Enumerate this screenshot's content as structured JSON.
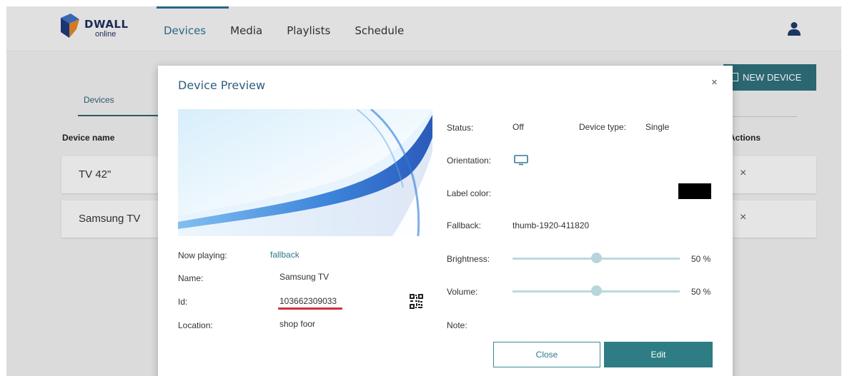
{
  "header": {
    "logo_word": "DWALL",
    "logo_sub": "online",
    "nav": [
      "Devices",
      "Media",
      "Playlists",
      "Schedule"
    ]
  },
  "page": {
    "new_device_label": "NEW DEVICE",
    "subtab_label": "Devices",
    "columns": {
      "device_name": "Device name",
      "actions": "Actions"
    },
    "rows": [
      {
        "name": "TV 42\"",
        "action": "×"
      },
      {
        "name": "Samsung TV",
        "action": "×"
      }
    ]
  },
  "modal": {
    "title": "Device Preview",
    "close_glyph": "×",
    "left_fields": [
      {
        "label": "Now playing:",
        "value": "fallback"
      },
      {
        "label": "Name:",
        "value": "Samsung TV"
      },
      {
        "label": "Id:",
        "value": "103662309033"
      },
      {
        "label": "Location:",
        "value": "shop foor"
      }
    ],
    "status": {
      "label": "Status:",
      "value": "Off"
    },
    "device_type": {
      "label": "Device type:",
      "value": "Single"
    },
    "orientation": {
      "label": "Orientation:",
      "icon": "monitor-landscape-icon"
    },
    "label_color": {
      "label": "Label color:",
      "color": "#000000"
    },
    "fallback": {
      "label": "Fallback:",
      "value": "thumb-1920-411820"
    },
    "brightness": {
      "label": "Brightness:",
      "value": 50,
      "display": "50 %"
    },
    "volume": {
      "label": "Volume:",
      "value": 50,
      "display": "50 %"
    },
    "note": {
      "label": "Note:"
    },
    "buttons": {
      "close": "Close",
      "edit": "Edit"
    }
  },
  "colors": {
    "accent": "#2e7d84",
    "nav_active": "#2e6f8c",
    "underline": "#d32f3a"
  }
}
